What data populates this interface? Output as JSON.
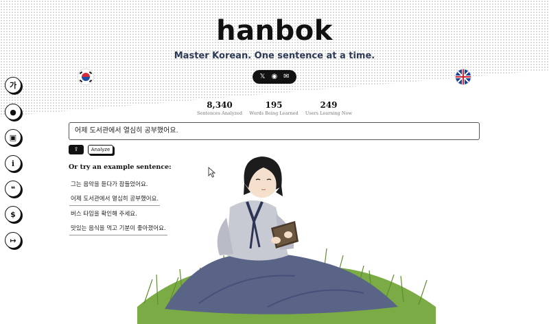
{
  "header": {
    "title": "hanbok",
    "tagline": "Master Korean. One sentence at a time."
  },
  "social": [
    {
      "name": "x-icon",
      "glyph": "𝕏"
    },
    {
      "name": "github-icon",
      "glyph": "◉"
    },
    {
      "name": "mail-icon",
      "glyph": "✉"
    }
  ],
  "language_flags": {
    "left": "korean-flag-icon",
    "right": "uk-flag-icon"
  },
  "sidebar": [
    {
      "name": "hangul-icon",
      "glyph": "가"
    },
    {
      "name": "user-icon",
      "glyph": "●"
    },
    {
      "name": "flashcards-icon",
      "glyph": "▣"
    },
    {
      "name": "info-icon",
      "glyph": "i"
    },
    {
      "name": "chat-icon",
      "glyph": "❝"
    },
    {
      "name": "dollar-icon",
      "glyph": "$"
    },
    {
      "name": "logout-icon",
      "glyph": "↦"
    }
  ],
  "stats": [
    {
      "value": "8,340",
      "label": "Sentences Analyzed"
    },
    {
      "value": "195",
      "label": "Words Being Learned"
    },
    {
      "value": "249",
      "label": "Users Learning Now"
    }
  ],
  "input": {
    "value": "어제 도서관에서 열심히 공부했어요."
  },
  "buttons": {
    "upload_glyph": "⇪",
    "analyze_label": "Analyze"
  },
  "examples": {
    "title": "Or try an example sentence:",
    "items": [
      "그는 음악을 듣다가 잠들었어요.",
      "어제 도서관에서 열심히 공부했어요.",
      "버스 타임을 확인해 주세요.",
      "맛있는 음식을 먹고 기분이 좋아졌어요."
    ]
  },
  "colors": {
    "accent": "#111111",
    "tagline": "#2d3a56",
    "hanbok_jacket": "#c7cad3",
    "hanbok_skirt": "#5a6487",
    "grass": "#6a9c3a"
  }
}
